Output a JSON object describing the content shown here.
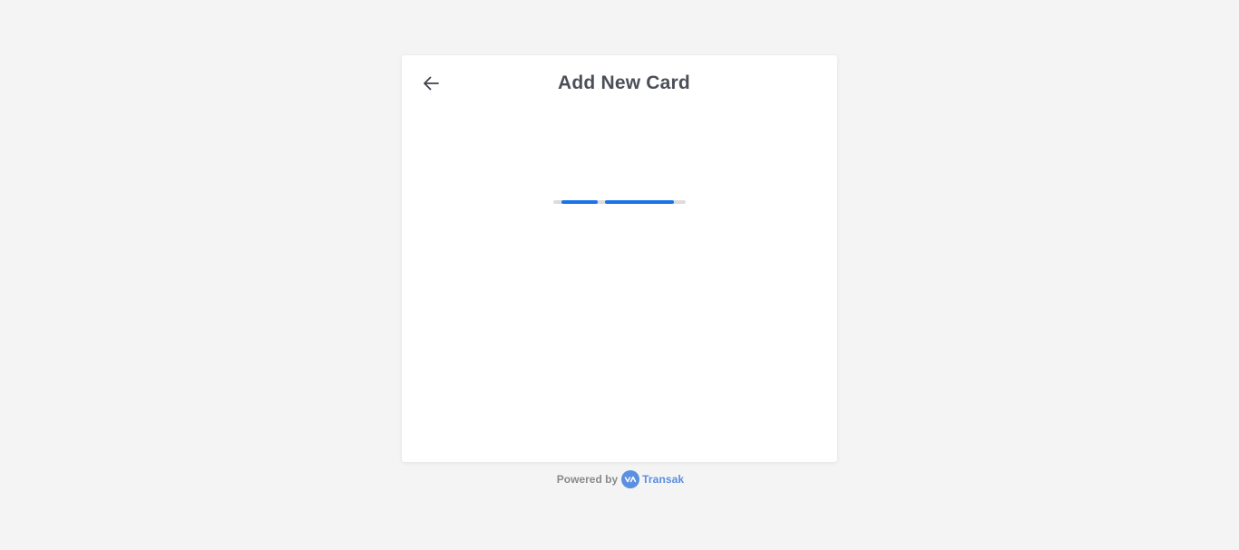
{
  "card": {
    "title": "Add New Card",
    "back_icon": "arrow-left-icon"
  },
  "loader": {
    "track_color": "#dcdcdc",
    "bar_color": "#1a73e8"
  },
  "footer": {
    "powered_label": "Powered by",
    "brand_name": "Transak",
    "brand_icon": "transak-logo-icon",
    "text_color": "#8a8a8a",
    "brand_color": "#5b8fe0"
  },
  "colors": {
    "page_background": "#f4f4f4",
    "card_background": "#ffffff",
    "title_color": "#4b4f58"
  }
}
